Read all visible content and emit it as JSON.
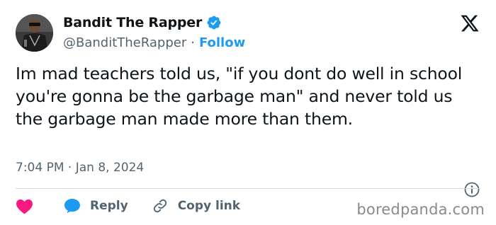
{
  "author": {
    "display_name": "Bandit The Rapper",
    "handle": "@BanditTheRapper",
    "separator": "·",
    "follow_label": "Follow"
  },
  "tweet": {
    "text": "Im mad teachers told us, \"if you dont do well in school you're gonna be the garbage man\" and never told us the garbage man made more than them.",
    "timestamp": "7:04 PM · Jan 8, 2024"
  },
  "actions": {
    "reply_label": "Reply",
    "copy_label": "Copy link"
  },
  "watermark": "boredpanda.com",
  "icons": {
    "brand": "x-logo-icon",
    "verified": "verified-badge-icon",
    "like": "heart-icon",
    "reply": "reply-bubble-icon",
    "copy": "link-icon",
    "info": "info-icon"
  },
  "colors": {
    "accent": "#1d9bf0",
    "like": "#f91880",
    "text": "#0f1419",
    "secondary": "#536471",
    "divider": "#cfd9de"
  }
}
